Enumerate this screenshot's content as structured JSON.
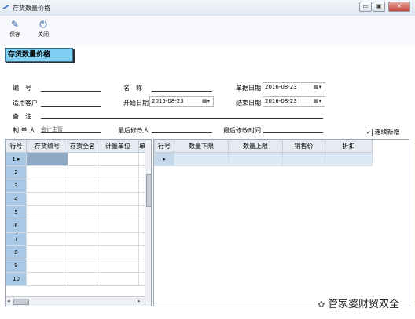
{
  "window": {
    "title": "存货数量价格",
    "controls": [
      "▭",
      "▣",
      "✕"
    ]
  },
  "toolbar": {
    "save_label": "保存",
    "close_label": "关闭"
  },
  "heading": "存货数量价格",
  "form": {
    "code_label": "编　号",
    "name_label": "名　称",
    "doc_date_label": "单据日期",
    "doc_date_value": "2016-08-23",
    "customer_label": "适用客户",
    "start_date_label": "开始日期",
    "start_date_value": "2016-08-23",
    "end_date_label": "结束日期",
    "end_date_value": "2016-08-23",
    "note_label": "备　注",
    "creator_label": "制 单 人",
    "creator_value": "会计主管",
    "modifier_label": "最后修改人",
    "modified_time_label": "最后修改时间",
    "continuous_add_label": "连续新增",
    "continuous_add_checked": true
  },
  "left_grid": {
    "headers": [
      "行号",
      "存货编号",
      "存货全名",
      "计量单位",
      "单"
    ],
    "rows": [
      "1",
      "2",
      "3",
      "4",
      "5",
      "6",
      "7",
      "8",
      "9",
      "10"
    ]
  },
  "right_grid": {
    "headers": [
      "行号",
      "数量下限",
      "数量上限",
      "销售价",
      "折扣"
    ]
  },
  "watermark": "管家婆财贸双全"
}
